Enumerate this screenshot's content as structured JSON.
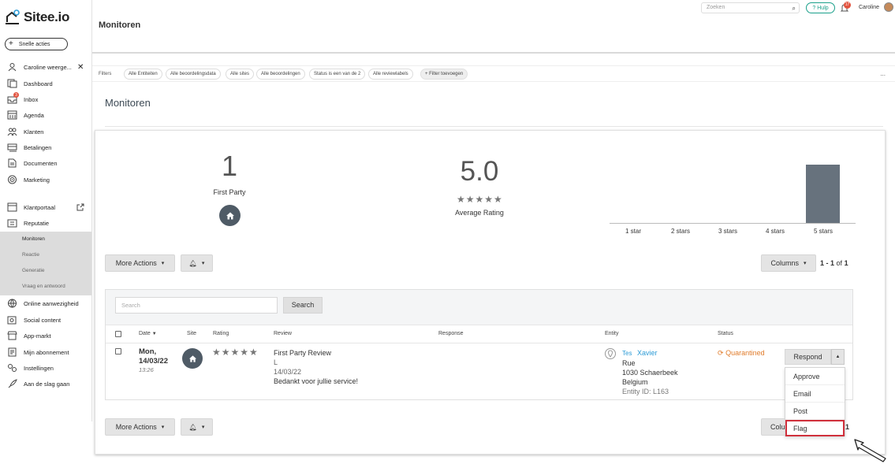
{
  "app": {
    "logo": "Sitee.io",
    "quick_actions": "Snelle acties"
  },
  "sidebar": {
    "items": [
      {
        "label": "Caroline weerge...",
        "icon": "user-icon"
      },
      {
        "label": "Dashboard",
        "icon": "dashboard-icon"
      },
      {
        "label": "Inbox",
        "icon": "inbox-icon",
        "badge": "3"
      },
      {
        "label": "Agenda",
        "icon": "calendar-icon"
      },
      {
        "label": "Klanten",
        "icon": "customers-icon"
      },
      {
        "label": "Betalingen",
        "icon": "payments-icon"
      },
      {
        "label": "Documenten",
        "icon": "documents-icon"
      },
      {
        "label": "Marketing",
        "icon": "marketing-icon"
      },
      {
        "label": "Klantportaal",
        "icon": "portal-icon"
      },
      {
        "label": "Reputatie",
        "icon": "reputation-icon"
      },
      {
        "label": "Online aanwezigheid",
        "icon": "globe-icon"
      },
      {
        "label": "Social content",
        "icon": "social-icon"
      },
      {
        "label": "App-markt",
        "icon": "store-icon"
      },
      {
        "label": "Mijn abonnement",
        "icon": "subscription-icon"
      },
      {
        "label": "Instellingen",
        "icon": "settings-icon"
      },
      {
        "label": "Aan de slag gaan",
        "icon": "rocket-icon"
      }
    ],
    "sub_items": [
      "Monitoren",
      "Reactie",
      "Generatie",
      "Vraag en antwoord"
    ]
  },
  "topbar": {
    "search_placeholder": "Zoeken",
    "help": "Hulp",
    "notif_count": "17",
    "user": "Caroline"
  },
  "page": {
    "header_title": "Monitoren",
    "section_title": "Monitoren"
  },
  "filters": {
    "label": "Filters",
    "chips": [
      "Alle Entiteiten",
      "Alle beoordelingsdata",
      "Alle sites",
      "Alle beoordelingen",
      "Status is een van de 2",
      "Alle reviewlabels"
    ],
    "add": "+ Filter toevoegen",
    "more": "..."
  },
  "stats": {
    "first_party_count": "1",
    "first_party_label": "First Party",
    "avg_rating": "5.0",
    "avg_stars": "★★★★★",
    "avg_label": "Average Rating"
  },
  "chart_data": {
    "type": "bar",
    "categories": [
      "1 star",
      "2 stars",
      "3 stars",
      "4 stars",
      "5 stars"
    ],
    "values": [
      0,
      0,
      0,
      0,
      1
    ]
  },
  "toolbar": {
    "more_actions": "More Actions",
    "columns": "Columns",
    "pager_range": "1 - 1",
    "pager_of": "of",
    "pager_total": "1"
  },
  "table": {
    "search_placeholder": "Search",
    "search_button": "Search",
    "headers": [
      "Date",
      "Site",
      "Rating",
      "Review",
      "Response",
      "Entity",
      "Status"
    ],
    "row": {
      "date_day": "Mon,",
      "date": "14/03/22",
      "time": "13:26",
      "stars": "★★★★★",
      "review_title": "First Party Review",
      "review_initial": "L",
      "review_date": "14/03/22",
      "review_text": "Bedankt voor jullie service!",
      "entity_prefix": "Tes",
      "entity_name": "Xavier",
      "entity_street": "Rue",
      "entity_city": "1030 Schaerbeek",
      "entity_country": "Belgium",
      "entity_id": "Entity ID: L163",
      "status": "Quarantined"
    }
  },
  "respond": {
    "button": "Respond",
    "menu": [
      "Approve",
      "Email",
      "Post",
      "Flag"
    ]
  },
  "bottom": {
    "columns_partial": "Colu",
    "pager_partial": "1"
  }
}
